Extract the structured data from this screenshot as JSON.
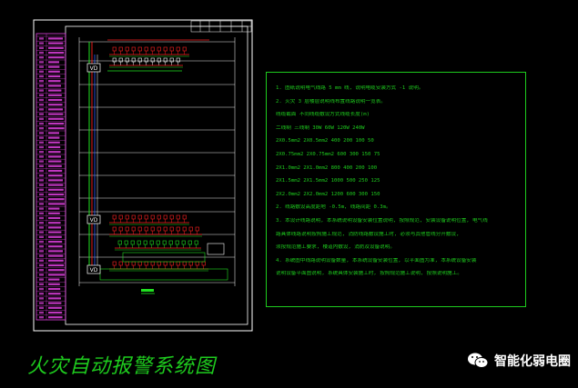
{
  "diagram": {
    "title": "火灾自动报警系统图",
    "colors": {
      "background": "#000000",
      "frame": "#ffffff",
      "notes": "#1ecb1e",
      "legend": "#e040e0",
      "wiring_red": "#ff2020",
      "wiring_green": "#20e020",
      "wiring_blue": "#3060ff"
    },
    "module_labels": [
      "VD",
      "VD",
      "VD"
    ],
    "notes": [
      "1. 图纸说明电气线路 5 mm 线, 说明电缆安装方式 -1 说明。",
      "2. 火灾 3 层楼层说明线布置线路说明一览表。",
      "线缆截面              不同线缆敷设方式线缆长度(m)",
      "二线制    三线制      30W  60W  120W  240W",
      "2X0.5mm2  2X0.5mm2   400  200  100  50",
      "2X0.75mm2 2X0.75mm2  600  300  150  75",
      "2X1.0mm2  2X1.0mm2   800  400  200  100",
      "2X1.5mm2  2X1.5mm2   1000 500  250  125",
      "2X2.0mm2  2X2.0mm2   1200 600  300  150",
      "2. 线路敷设高度距地 -0.5m, 线路间距 0.3m。",
      "3. 本设计线路说明, 本系统说明设备安装位置说明, 按照规范, 安装设备说明位置, 电气线",
      "路具体线路说明按照施工规范, 消防线路敷设施工时, 必须与其他管线分开敷设,",
      "须按规范施工要求, 楼道内敷设, 消防及设备说明。",
      "4. 系统图中线路说明设备数量, 本系统设备安装位置, 以平面图为准, 本系统设备安装",
      "说明设备平面图说明, 系统具体安装施工时, 按照规范施工说明, 按照说明施工。"
    ]
  },
  "watermark": {
    "text": "智能化弱电圈",
    "icon": "wechat-icon"
  }
}
